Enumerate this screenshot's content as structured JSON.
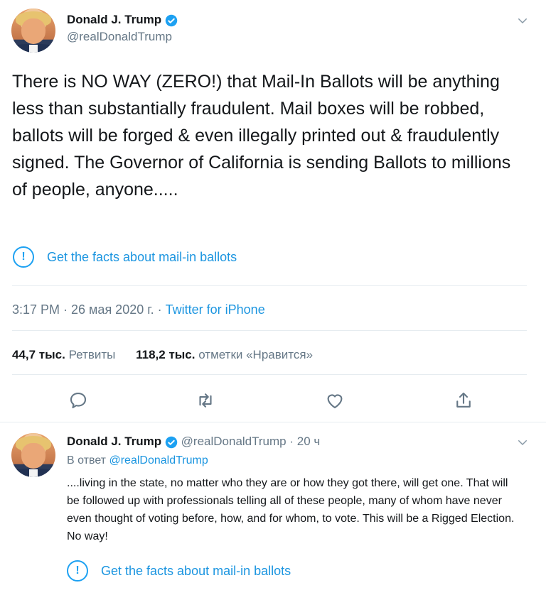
{
  "tweet": {
    "author_name": "Donald J. Trump",
    "author_handle": "@realDonaldTrump",
    "text": "There is NO WAY (ZERO!) that Mail-In Ballots will be anything less than substantially fraudulent. Mail boxes will be robbed, ballots will be forged & even illegally printed out & fraudulently signed. The Governor of California is sending Ballots to millions of people, anyone.....",
    "fact_check": "Get the facts about mail-in ballots",
    "time": "3:17 PM · 26 мая 2020 г.",
    "separator": "·",
    "source": "Twitter for iPhone",
    "retweets_count": "44,7 тыс.",
    "retweets_label": "Ретвиты",
    "likes_count": "118,2 тыс.",
    "likes_label": "отметки «Нравится»"
  },
  "reply": {
    "author_name": "Donald J. Trump",
    "author_handle": "@realDonaldTrump",
    "dot": "·",
    "age": "20 ч",
    "in_reply_prefix": "В ответ",
    "in_reply_handle": "@realDonaldTrump",
    "text": "....living in the state, no matter who they are or how they got there, will get one. That will be followed up with professionals telling all of these people, many of whom have never even thought of voting before, how, and for whom, to vote. This will be a Rigged Election. No way!",
    "fact_check": "Get the facts about mail-in ballots"
  },
  "colors": {
    "accent": "#1da1f2",
    "link": "#1b95e0",
    "muted": "#657786",
    "text": "#14171a",
    "divider": "#e6ecf0"
  },
  "icons": {
    "verified": "verified-badge-icon",
    "chevron": "chevron-down-icon",
    "reply": "reply-icon",
    "retweet": "retweet-icon",
    "like": "heart-icon",
    "share": "share-icon",
    "info": "info-icon"
  }
}
